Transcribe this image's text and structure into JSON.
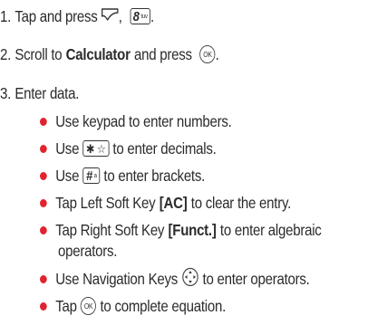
{
  "steps": [
    {
      "num": "1.",
      "tap_and_press": "Tap and press",
      "comma": ",",
      "key_8_main": "8",
      "key_8_sub": "tuv",
      "end": "."
    },
    {
      "num": "2.",
      "pre": "Scroll to",
      "bold": "Calculator",
      "mid": "and press",
      "ok_label": "OK",
      "end": "."
    },
    {
      "num": "3.",
      "text": "Enter data."
    }
  ],
  "bullets": {
    "b1": "Use keypad to enter numbers.",
    "b2_pre": "Use",
    "b2_key": "✱ ☆",
    "b2_post": "to enter decimals.",
    "b3_pre": "Use",
    "b3_key": "#",
    "b3_key_sub": "a",
    "b3_post": "to enter brackets.",
    "b4_pre": "Tap Left Soft Key",
    "b4_bold": "[AC]",
    "b4_post": "to clear the entry.",
    "b5_pre": "Tap Right Soft Key",
    "b5_bold": "[Funct.]",
    "b5_post": "to enter algebraic",
    "b5_cont": "operators.",
    "b6_pre": "Use Navigation Keys",
    "b6_post": "to enter operators.",
    "b7_pre": "Tap",
    "b7_ok": "OK",
    "b7_post": "to complete equation."
  },
  "colors": {
    "bullet": "#e0242f",
    "text": "#2b2b2b"
  },
  "icons": [
    "menu-soft-key-icon",
    "ok-key-icon",
    "navigation-keys-icon",
    "star-key-icon",
    "hash-key-icon",
    "eight-key-icon"
  ]
}
